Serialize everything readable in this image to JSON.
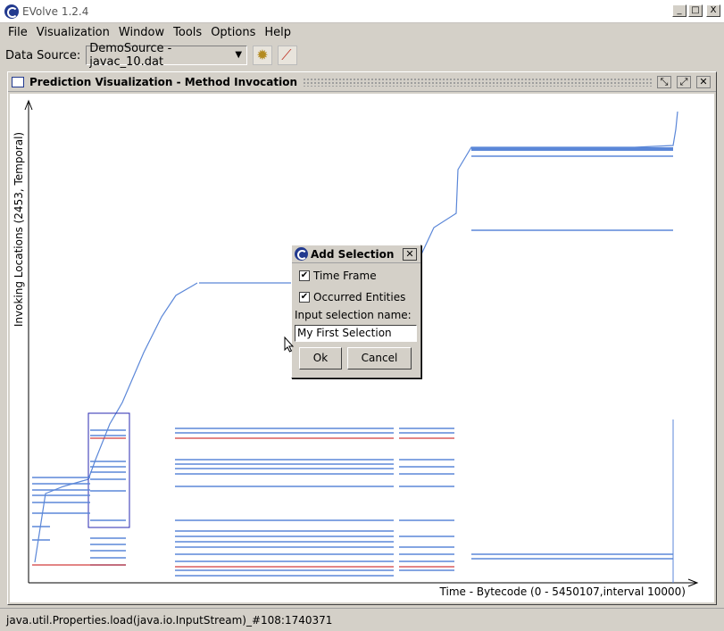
{
  "app": {
    "title": "EVolve 1.2.4"
  },
  "window_buttons": {
    "minimize": "_",
    "maximize": "□",
    "close": "X"
  },
  "menu": [
    "File",
    "Visualization",
    "Window",
    "Tools",
    "Options",
    "Help"
  ],
  "toolbar": {
    "data_source_label": "Data Source:",
    "data_source_value": "DemoSource - javac_10.dat",
    "icons": [
      "gear-icon",
      "chart-icon"
    ]
  },
  "frame": {
    "title": "Prediction Visualization - Method Invocation",
    "buttons": [
      "minimize-icon",
      "maximize-icon",
      "close-icon"
    ]
  },
  "plot": {
    "ylabel": "Invoking Locations (2453, Temporal)",
    "xlabel": "Time - Bytecode (0 - 5450107,interval 10000)"
  },
  "dialog": {
    "title": "Add Selection",
    "checkbox_time_frame": "Time Frame",
    "checkbox_occurred_entities": "Occurred Entities",
    "time_frame_checked": true,
    "occurred_entities_checked": true,
    "prompt": "Input selection name:",
    "input_value": "My First Selection",
    "ok_label": "Ok",
    "cancel_label": "Cancel"
  },
  "statusbar": {
    "text": "java.util.Properties.load(java.io.InputStream)_#108:1740371"
  },
  "colors": {
    "series_blue": "#5b87d8",
    "series_red": "#d23c3c",
    "selection_box": "#2a2ab0"
  }
}
